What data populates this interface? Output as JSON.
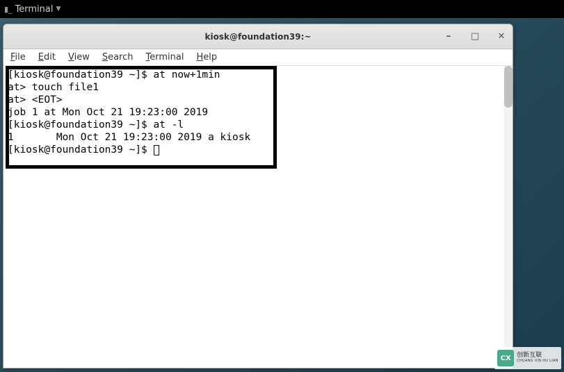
{
  "panel": {
    "app_label": "Terminal"
  },
  "window": {
    "title": "kiosk@foundation39:~",
    "controls": {
      "minimize": "–",
      "maximize": "□",
      "close": "✕"
    }
  },
  "menubar": {
    "file": "File",
    "edit": "Edit",
    "view": "View",
    "search": "Search",
    "terminal": "Terminal",
    "help": "Help"
  },
  "terminal": {
    "lines": [
      "[kiosk@foundation39 ~]$ at now+1min",
      "at> touch file1",
      "at> <EOT>",
      "job 1 at Mon Oct 21 19:23:00 2019",
      "[kiosk@foundation39 ~]$ at -l",
      "1       Mon Oct 21 19:23:00 2019 a kiosk",
      "[kiosk@foundation39 ~]$ "
    ]
  },
  "watermark": {
    "logo": "CX",
    "line1": "创新互联",
    "line2": "CHUANG XIN HU LIAN"
  }
}
